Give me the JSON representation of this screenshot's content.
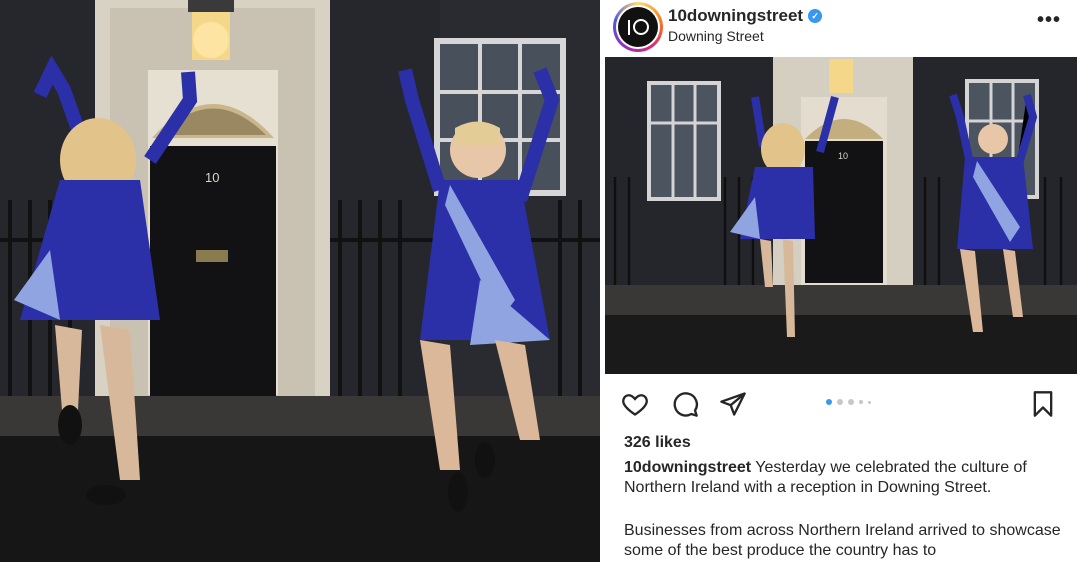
{
  "post": {
    "username": "10downingstreet",
    "location": "Downing Street",
    "avatar_text": "10",
    "verified": true,
    "likes": "326 likes",
    "caption_user": "10downingstreet",
    "caption_text": " Yesterday we celebrated the culture of Northern Ireland with a reception in Downing Street.",
    "caption_text_2": "Businesses from across Northern Ireland arrived to showcase some of the best produce the country has to"
  },
  "photo": {
    "door_number": "10",
    "description_colors": {
      "dress": "#2b2fa8",
      "tartan": "#8fa4e0",
      "door": "#121214"
    }
  },
  "carousel": {
    "count": 5,
    "active_index": 0
  },
  "icons": {
    "like": "heart-icon",
    "comment": "comment-icon",
    "share": "paper-plane-icon",
    "save": "bookmark-icon",
    "more": "more-horizontal-icon"
  },
  "colors": {
    "verified": "#3897f0",
    "text": "#262626",
    "active_dot": "#3897f0"
  }
}
